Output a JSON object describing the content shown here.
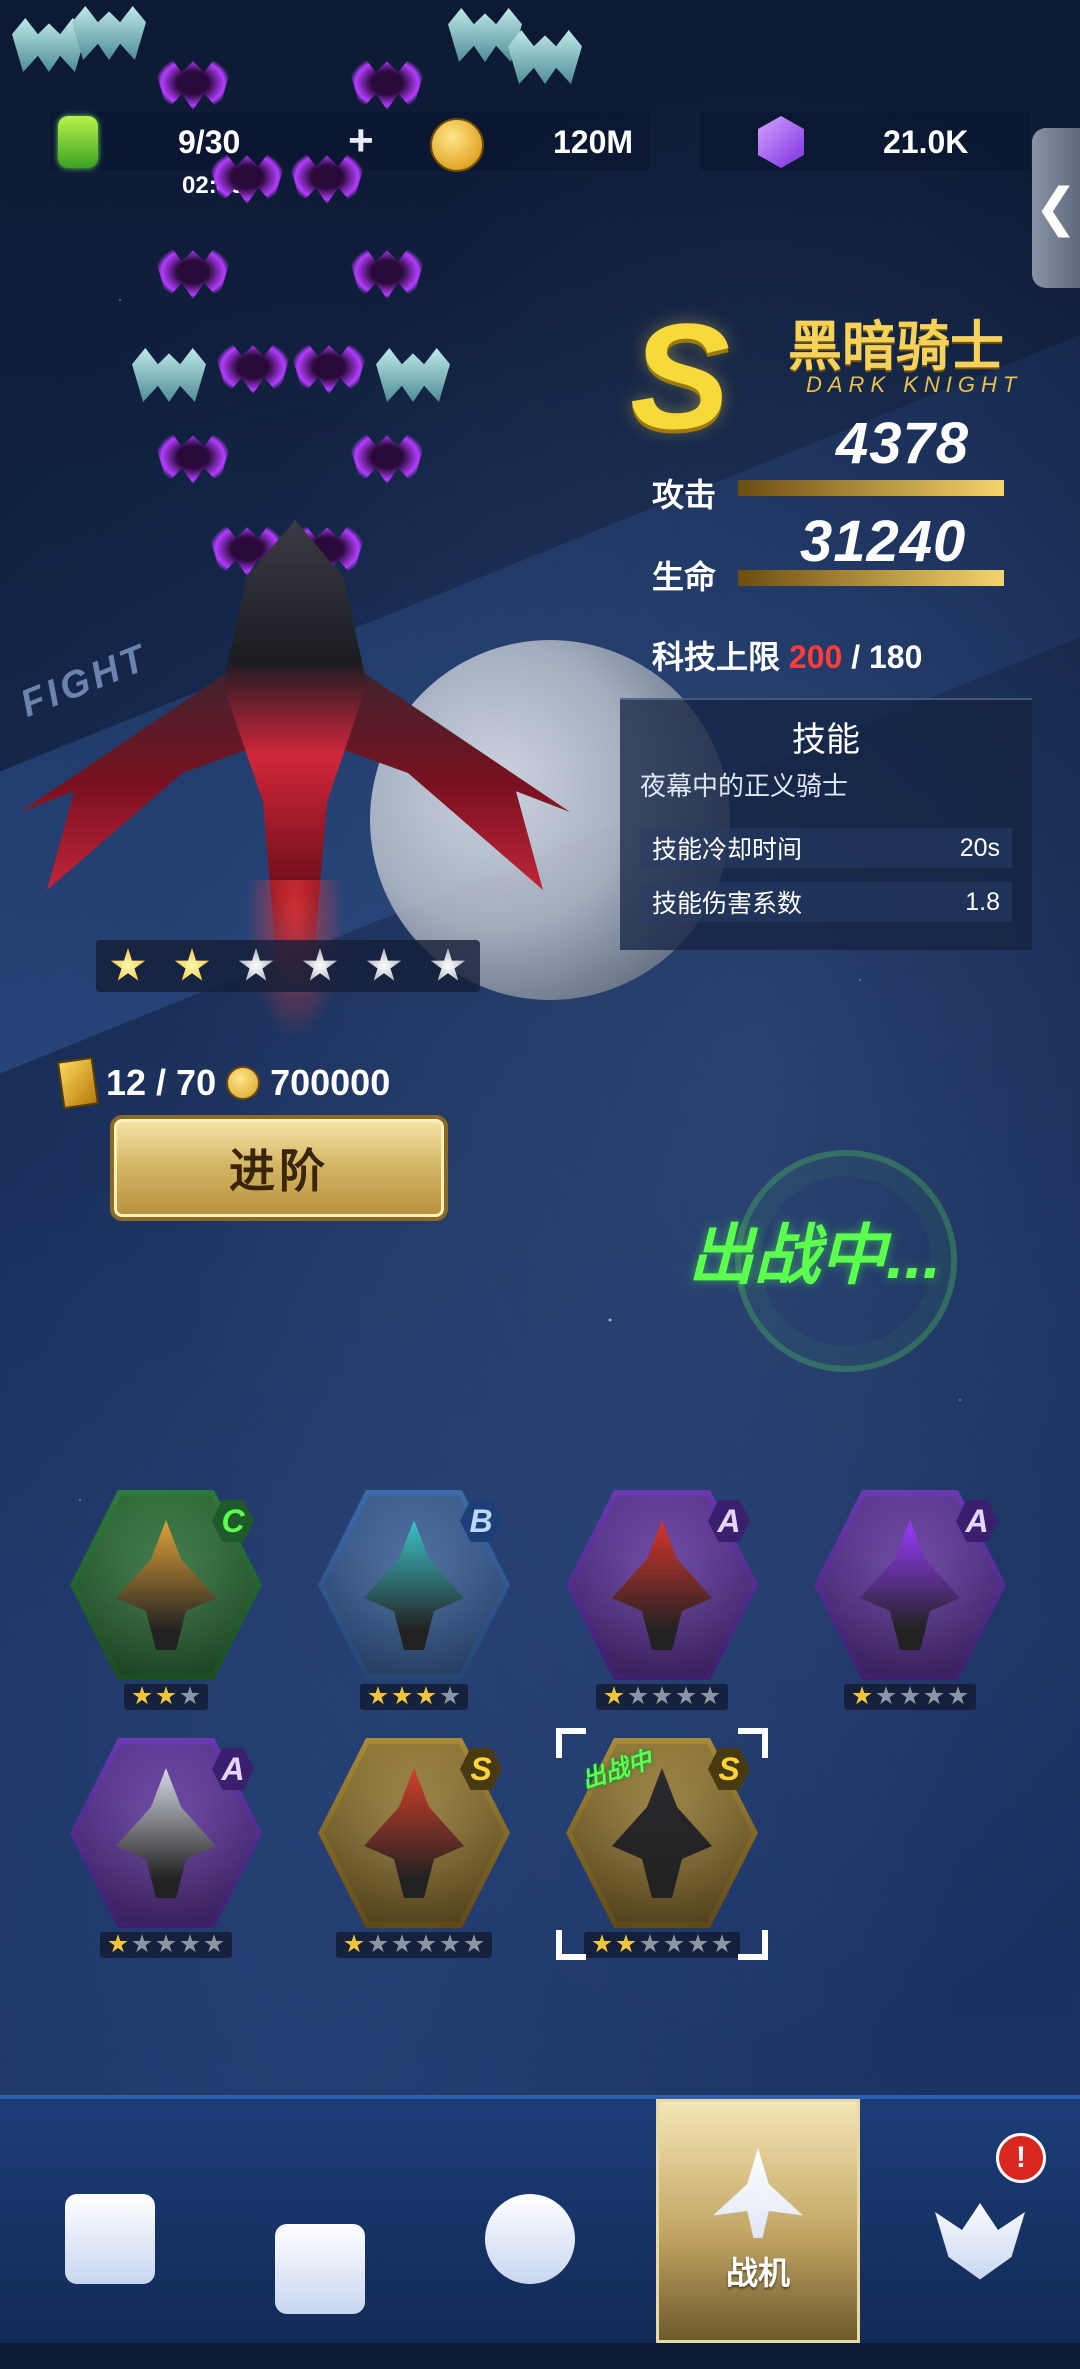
{
  "resources": {
    "energy": "9/30",
    "energy_timer": "02:46",
    "plus_symbol": "+",
    "coins": "120M",
    "gems": "21.0K"
  },
  "side_tab": {
    "glyph": "❮"
  },
  "background": {
    "fight_text": "FIGHT"
  },
  "ship": {
    "rank": "S",
    "name": "黑暗骑士",
    "subname": "DARK KNIGHT",
    "attack_label": "攻击",
    "attack_value": "4378",
    "hp_label": "生命",
    "hp_value": "31240",
    "tech_label": "科技上限",
    "tech_current": "200",
    "tech_separator": "/",
    "tech_max": "180",
    "star_rating": {
      "gold": 2,
      "total": 6
    }
  },
  "skill": {
    "title": "技能",
    "description": "夜幕中的正义骑士",
    "rows": [
      {
        "label": "技能冷却时间",
        "value": "20s"
      },
      {
        "label": "技能伤害系数",
        "value": "1.8"
      }
    ]
  },
  "upgrade": {
    "fragments": "12 / 70",
    "cost": "700000",
    "button_label": "进阶"
  },
  "status": {
    "in_battle": "出战中..."
  },
  "fleet": [
    {
      "grade": "C",
      "color": "green",
      "stars_gold": 2,
      "stars_total": 3,
      "ship_color": "#e0a23a"
    },
    {
      "grade": "B",
      "color": "blue",
      "stars_gold": 3,
      "stars_total": 4,
      "ship_color": "#3cc4c9"
    },
    {
      "grade": "A",
      "color": "purple",
      "stars_gold": 1,
      "stars_total": 5,
      "ship_color": "#d8352c"
    },
    {
      "grade": "A",
      "color": "purple",
      "stars_gold": 1,
      "stars_total": 5,
      "ship_color": "#9a3cff"
    },
    {
      "grade": "A",
      "color": "purple",
      "stars_gold": 1,
      "stars_total": 5,
      "ship_color": "#d7dbe6"
    },
    {
      "grade": "S",
      "color": "gold",
      "stars_gold": 1,
      "stars_total": 6,
      "ship_color": "#d4402a"
    },
    {
      "grade": "S",
      "color": "gold",
      "stars_gold": 2,
      "stars_total": 6,
      "ship_color": "#2a2a30",
      "selected": true,
      "tag": "出战中"
    }
  ],
  "nav": {
    "active_label": "战机",
    "alert": "!"
  },
  "colors": {
    "accent_gold": "#f7d93a",
    "battle_green": "#5dff4f",
    "alert_red": "#ff3b3b"
  }
}
